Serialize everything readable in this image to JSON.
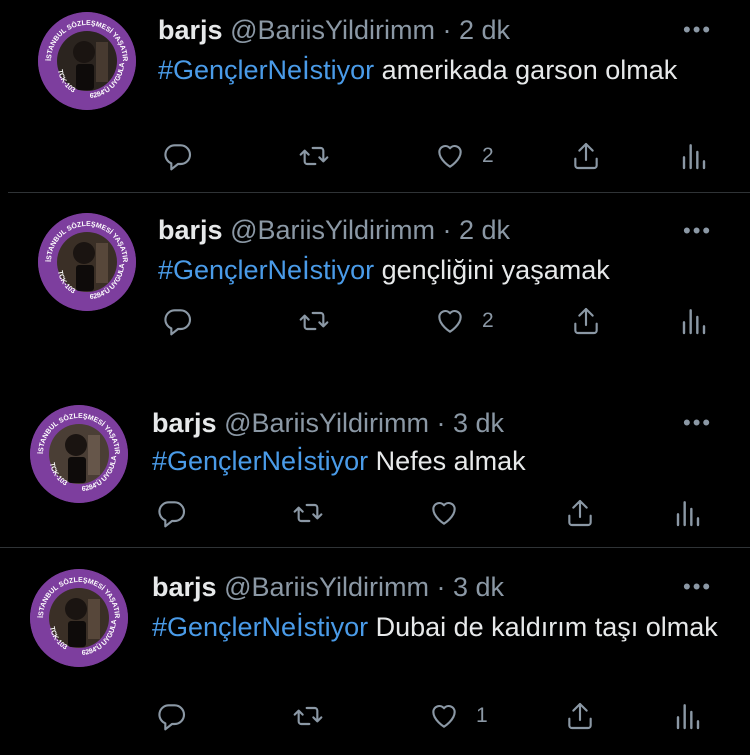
{
  "tweets": [
    {
      "name": "barjs",
      "handle": "@BariisYildirimm",
      "sep": "·",
      "time": "2 dk",
      "hashtag": "#GençlerNeİstiyor",
      "text": " amerikada garson olmak",
      "likes": "2",
      "avatar_badge": {
        "top": "İSTANBUL SÖZLEŞMESİ YAŞATIR",
        "left": "TCK-103",
        "right": "6284'Ü UYGULA"
      }
    },
    {
      "name": "barjs",
      "handle": "@BariisYildirimm",
      "sep": "·",
      "time": "2 dk",
      "hashtag": "#GençlerNeİstiyor",
      "text": " gençliğini yaşamak",
      "likes": "2",
      "avatar_badge": {
        "top": "İSTANBUL SÖZLEŞMESİ YAŞATIR",
        "left": "TCK-103",
        "right": "6284'Ü UYGULA"
      }
    },
    {
      "name": "barjs",
      "handle": "@BariisYildirimm",
      "sep": "·",
      "time": "3 dk",
      "hashtag": "#GençlerNeİstiyor",
      "text": " Nefes almak",
      "likes": "",
      "avatar_badge": {
        "top": "İSTANBUL SÖZLEŞMESİ YAŞATIR",
        "left": "TCK-103",
        "right": "6284'Ü UYGULA"
      }
    },
    {
      "name": "barjs",
      "handle": "@BariisYildirimm",
      "sep": "·",
      "time": "3 dk",
      "hashtag": "#GençlerNeİstiyor",
      "text": " Dubai de kaldırım taşı olmak",
      "likes": "1",
      "avatar_badge": {
        "top": "İSTANBUL SÖZLEŞMESİ YAŞATIR",
        "left": "TCK-103",
        "right": "6284'Ü UYGULA"
      }
    }
  ],
  "icons": {
    "more": "more-horizontal-icon",
    "reply": "reply-icon",
    "retweet": "retweet-icon",
    "like": "like-heart-icon",
    "share": "share-icon",
    "analytics": "analytics-icon"
  },
  "more_glyph": "•••",
  "colors": {
    "background": "#000000",
    "text": "#e7e9ea",
    "secondary": "#8b98a5",
    "hashtag": "#4a9be8",
    "avatar_ring": "#7d3e9e",
    "divider": "#2f3336"
  }
}
